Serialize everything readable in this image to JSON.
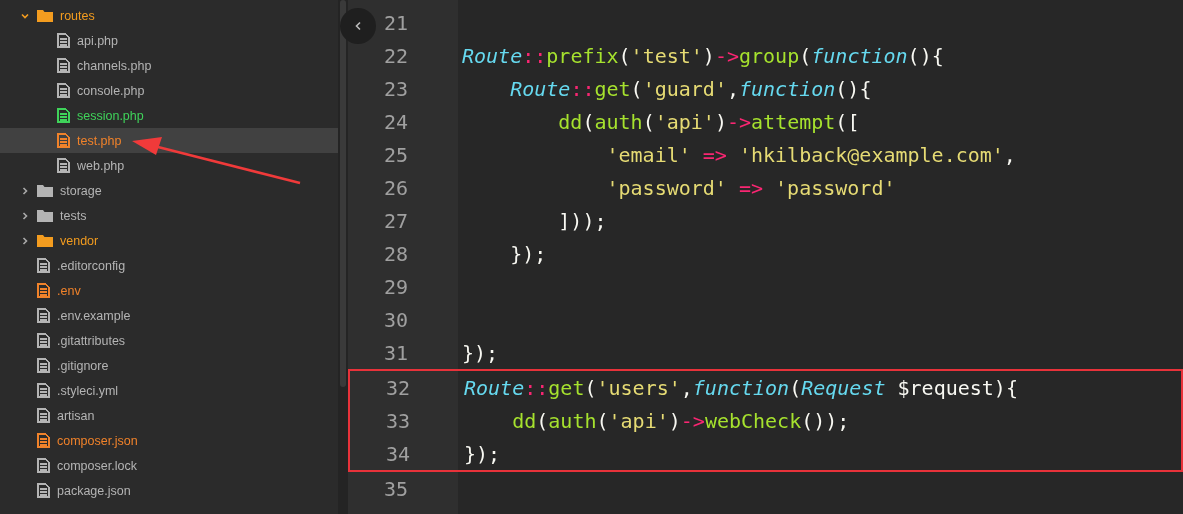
{
  "sidebar": {
    "items": [
      {
        "kind": "folder",
        "name": "routes",
        "expanded": true,
        "color": "#f39c1f",
        "selected": false,
        "children": [
          {
            "kind": "file",
            "name": "api.php",
            "color": "#b4b4b4",
            "selected": false
          },
          {
            "kind": "file",
            "name": "channels.php",
            "color": "#b4b4b4",
            "selected": false
          },
          {
            "kind": "file",
            "name": "console.php",
            "color": "#b4b4b4",
            "selected": false
          },
          {
            "kind": "file",
            "name": "session.php",
            "color": "#3fd35a",
            "selected": false
          },
          {
            "kind": "file",
            "name": "test.php",
            "color": "#f0822a",
            "selected": true
          },
          {
            "kind": "file",
            "name": "web.php",
            "color": "#b4b4b4",
            "selected": false
          }
        ]
      },
      {
        "kind": "folder",
        "name": "storage",
        "expanded": false,
        "color": "#b4b4b4",
        "selected": false
      },
      {
        "kind": "folder",
        "name": "tests",
        "expanded": false,
        "color": "#b4b4b4",
        "selected": false
      },
      {
        "kind": "folder",
        "name": "vendor",
        "expanded": false,
        "color": "#f39c1f",
        "selected": false
      },
      {
        "kind": "file",
        "name": ".editorconfig",
        "color": "#b4b4b4",
        "selected": false
      },
      {
        "kind": "file",
        "name": ".env",
        "color": "#f0822a",
        "selected": false
      },
      {
        "kind": "file",
        "name": ".env.example",
        "color": "#b4b4b4",
        "selected": false
      },
      {
        "kind": "file",
        "name": ".gitattributes",
        "color": "#b4b4b4",
        "selected": false
      },
      {
        "kind": "file",
        "name": ".gitignore",
        "color": "#b4b4b4",
        "selected": false
      },
      {
        "kind": "file",
        "name": ".styleci.yml",
        "color": "#b4b4b4",
        "selected": false
      },
      {
        "kind": "file",
        "name": "artisan",
        "color": "#b4b4b4",
        "selected": false
      },
      {
        "kind": "file",
        "name": "composer.json",
        "color": "#f0822a",
        "selected": false
      },
      {
        "kind": "file",
        "name": "composer.lock",
        "color": "#b4b4b4",
        "selected": false
      },
      {
        "kind": "file",
        "name": "package.json",
        "color": "#b4b4b4",
        "selected": false
      }
    ]
  },
  "editor": {
    "lines": [
      {
        "number": "21",
        "boxed": false
      },
      {
        "number": "22",
        "boxed": false,
        "tokens": [
          {
            "kind": "cls",
            "text": "Route"
          },
          {
            "kind": "op",
            "text": "::"
          },
          {
            "kind": "fn",
            "text": "prefix"
          },
          {
            "kind": "plain",
            "text": "("
          },
          {
            "kind": "str",
            "text": "'test'"
          },
          {
            "kind": "plain",
            "text": ")"
          },
          {
            "kind": "op",
            "text": "->"
          },
          {
            "kind": "fn",
            "text": "group"
          },
          {
            "kind": "plain",
            "text": "("
          },
          {
            "kind": "kw",
            "text": "function"
          },
          {
            "kind": "plain",
            "text": "(){"
          }
        ]
      },
      {
        "number": "23",
        "boxed": false,
        "tokens": [
          {
            "kind": "cls",
            "text": "    Route"
          },
          {
            "kind": "op",
            "text": "::"
          },
          {
            "kind": "fn",
            "text": "get"
          },
          {
            "kind": "plain",
            "text": "("
          },
          {
            "kind": "str",
            "text": "'guard'"
          },
          {
            "kind": "plain",
            "text": ","
          },
          {
            "kind": "kw",
            "text": "function"
          },
          {
            "kind": "plain",
            "text": "(){"
          }
        ]
      },
      {
        "number": "24",
        "boxed": false,
        "tokens": [
          {
            "kind": "fn",
            "text": "        dd"
          },
          {
            "kind": "plain",
            "text": "("
          },
          {
            "kind": "fn",
            "text": "auth"
          },
          {
            "kind": "plain",
            "text": "("
          },
          {
            "kind": "str",
            "text": "'api'"
          },
          {
            "kind": "plain",
            "text": ")"
          },
          {
            "kind": "op",
            "text": "->"
          },
          {
            "kind": "fn",
            "text": "attempt"
          },
          {
            "kind": "plain",
            "text": "(["
          }
        ]
      },
      {
        "number": "25",
        "boxed": false,
        "tokens": [
          {
            "kind": "str",
            "text": "            'email'"
          },
          {
            "kind": "op",
            "text": " => "
          },
          {
            "kind": "str",
            "text": "'hkilback@example.com'"
          },
          {
            "kind": "plain",
            "text": ","
          }
        ]
      },
      {
        "number": "26",
        "boxed": false,
        "tokens": [
          {
            "kind": "str",
            "text": "            'password'"
          },
          {
            "kind": "op",
            "text": " => "
          },
          {
            "kind": "str",
            "text": "'password'"
          }
        ]
      },
      {
        "number": "27",
        "boxed": false,
        "tokens": [
          {
            "kind": "plain",
            "text": "        ]));"
          }
        ]
      },
      {
        "number": "28",
        "boxed": false,
        "tokens": [
          {
            "kind": "plain",
            "text": "    });"
          }
        ]
      },
      {
        "number": "29",
        "boxed": false
      },
      {
        "number": "30",
        "boxed": false
      },
      {
        "number": "31",
        "boxed": false,
        "tokens": [
          {
            "kind": "plain",
            "text": "});"
          }
        ]
      },
      {
        "number": "32",
        "boxed": true,
        "tokens": [
          {
            "kind": "cls",
            "text": "Route"
          },
          {
            "kind": "op",
            "text": "::"
          },
          {
            "kind": "fn",
            "text": "get"
          },
          {
            "kind": "plain",
            "text": "("
          },
          {
            "kind": "str",
            "text": "'users'"
          },
          {
            "kind": "plain",
            "text": ","
          },
          {
            "kind": "kw",
            "text": "function"
          },
          {
            "kind": "plain",
            "text": "("
          },
          {
            "kind": "cls",
            "text": "Request"
          },
          {
            "kind": "plain",
            "text": " $request){"
          }
        ]
      },
      {
        "number": "33",
        "boxed": true,
        "tokens": [
          {
            "kind": "fn",
            "text": "    dd"
          },
          {
            "kind": "plain",
            "text": "("
          },
          {
            "kind": "fn",
            "text": "auth"
          },
          {
            "kind": "plain",
            "text": "("
          },
          {
            "kind": "str",
            "text": "'api'"
          },
          {
            "kind": "plain",
            "text": ")"
          },
          {
            "kind": "op",
            "text": "->"
          },
          {
            "kind": "fn",
            "text": "webCheck"
          },
          {
            "kind": "plain",
            "text": "());"
          }
        ]
      },
      {
        "number": "34",
        "boxed": true,
        "tokens": [
          {
            "kind": "plain",
            "text": "});"
          }
        ]
      },
      {
        "number": "35",
        "boxed": false
      }
    ]
  }
}
